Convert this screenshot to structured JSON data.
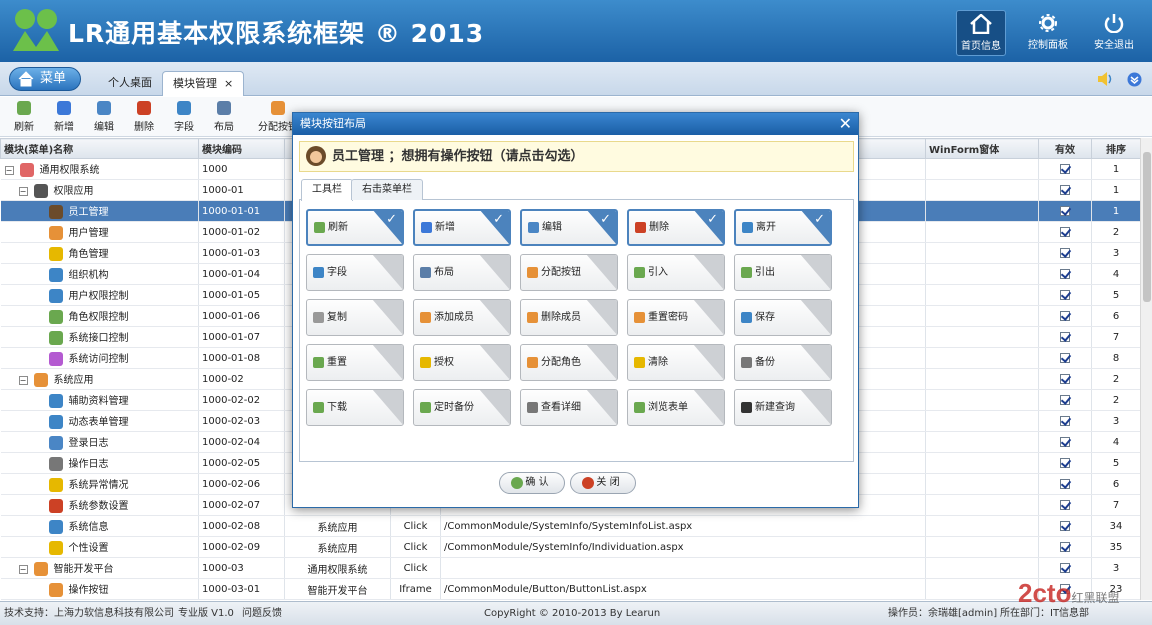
{
  "header": {
    "title": "LR通用基本权限系统框架 ® 2013",
    "buttons": [
      {
        "label": "首页信息",
        "icon": "home-icon"
      },
      {
        "label": "控制面板",
        "icon": "gear-icon"
      },
      {
        "label": "安全退出",
        "icon": "power-icon"
      }
    ]
  },
  "tabbar": {
    "menu_label": "菜单",
    "tabs": [
      {
        "label": "个人桌面"
      },
      {
        "label": "模块管理",
        "close": "×"
      }
    ]
  },
  "toolbar": {
    "buttons": [
      {
        "label": "刷新",
        "color": "#6aa84f"
      },
      {
        "label": "新增",
        "color": "#3c78d8"
      },
      {
        "label": "编辑",
        "color": "#4a86c5"
      },
      {
        "label": "删除",
        "color": "#cc4125"
      },
      {
        "label": "字段",
        "color": "#3d85c6"
      },
      {
        "label": "布局",
        "color": "#5b7ea8"
      },
      {
        "label": "分配按钮",
        "color": "#e69138"
      }
    ]
  },
  "grid": {
    "columns": [
      "模块(菜单)名称",
      "模块编码",
      "",
      "",
      "",
      "WinForm窗体",
      "有效",
      "排序"
    ],
    "rows": [
      {
        "level": 0,
        "exp": "⊟",
        "name": "通用权限系统",
        "code": "1000",
        "sort": "1",
        "color": "#e06666"
      },
      {
        "level": 1,
        "exp": "⊟",
        "name": "权限应用",
        "code": "1000-01",
        "sort": "1",
        "color": "#555555"
      },
      {
        "level": 2,
        "name": "员工管理",
        "code": "1000-01-01",
        "sort": "1",
        "color": "#6b4b2a",
        "sel": true
      },
      {
        "level": 2,
        "name": "用户管理",
        "code": "1000-01-02",
        "sort": "2",
        "color": "#e69138"
      },
      {
        "level": 2,
        "name": "角色管理",
        "code": "1000-01-03",
        "sort": "3",
        "color": "#e6b800"
      },
      {
        "level": 2,
        "name": "组织机构",
        "code": "1000-01-04",
        "sort": "4",
        "color": "#3d85c6"
      },
      {
        "level": 2,
        "name": "用户权限控制",
        "code": "1000-01-05",
        "sort": "5",
        "color": "#3d85c6"
      },
      {
        "level": 2,
        "name": "角色权限控制",
        "code": "1000-01-06",
        "sort": "6",
        "color": "#6aa84f"
      },
      {
        "level": 2,
        "name": "系统接口控制",
        "code": "1000-01-07",
        "sort": "7",
        "color": "#6aa84f"
      },
      {
        "level": 2,
        "name": "系统访问控制",
        "code": "1000-01-08",
        "sort": "8",
        "color": "#b45ad1"
      },
      {
        "level": 1,
        "exp": "⊟",
        "name": "系统应用",
        "code": "1000-02",
        "sort": "2",
        "color": "#e69138"
      },
      {
        "level": 2,
        "name": "辅助资料管理",
        "code": "1000-02-02",
        "sort": "2",
        "color": "#3d85c6"
      },
      {
        "level": 2,
        "name": "动态表单管理",
        "code": "1000-02-03",
        "sort": "3",
        "color": "#3d85c6"
      },
      {
        "level": 2,
        "name": "登录日志",
        "code": "1000-02-04",
        "sort": "4",
        "color": "#4a86c5"
      },
      {
        "level": 2,
        "name": "操作日志",
        "code": "1000-02-05",
        "sort": "5",
        "color": "#777777"
      },
      {
        "level": 2,
        "name": "系统异常情况",
        "code": "1000-02-06",
        "sort": "6",
        "color": "#e6b800"
      },
      {
        "level": 2,
        "name": "系统参数设置",
        "code": "1000-02-07",
        "sort": "7",
        "color": "#cc4125"
      },
      {
        "level": 2,
        "name": "系统信息",
        "code": "1000-02-08",
        "c3": "系统应用",
        "c4": "Click",
        "c5": "/CommonModule/SystemInfo/SystemInfoList.aspx",
        "sort": "34",
        "color": "#3d85c6"
      },
      {
        "level": 2,
        "name": "个性设置",
        "code": "1000-02-09",
        "c3": "系统应用",
        "c4": "Click",
        "c5": "/CommonModule/SystemInfo/Individuation.aspx",
        "sort": "35",
        "color": "#e6b800"
      },
      {
        "level": 1,
        "exp": "⊟",
        "name": "智能开发平台",
        "code": "1000-03",
        "c3": "通用权限系统",
        "c4": "Click",
        "c5": "",
        "sort": "3",
        "color": "#e69138"
      },
      {
        "level": 2,
        "name": "操作按钮",
        "code": "1000-03-01",
        "c3": "智能开发平台",
        "c4": "Iframe",
        "c5": "/CommonModule/Button/ButtonList.aspx",
        "sort": "23",
        "color": "#e69138"
      }
    ]
  },
  "footer": {
    "support": "技术支持：上海力软信息科技有限公司",
    "version": "专业版 V1.0",
    "feedback": "问题反馈",
    "copyright": "CopyRight © 2010-2013 By Learun",
    "operator": "操作员：余瑞雄[admin]",
    "dept": "所在部门：IT信息部"
  },
  "watermark": {
    "text": "2cto",
    "sub": "红黑联盟"
  },
  "dialog": {
    "title": "模块按钮布局",
    "subtitle": "员工管理 ；想拥有操作按钮（请点击勾选）",
    "tabs": [
      "工具栏",
      "右击菜单栏"
    ],
    "buttons": [
      {
        "label": "刷新",
        "on": true,
        "color": "#6aa84f"
      },
      {
        "label": "新增",
        "on": true,
        "color": "#3c78d8"
      },
      {
        "label": "编辑",
        "on": true,
        "color": "#4a86c5"
      },
      {
        "label": "删除",
        "on": true,
        "color": "#cc4125"
      },
      {
        "label": "离开",
        "on": true,
        "color": "#3d85c6"
      },
      {
        "label": "字段",
        "color": "#3d85c6"
      },
      {
        "label": "布局",
        "color": "#5b7ea8"
      },
      {
        "label": "分配按钮",
        "color": "#e69138"
      },
      {
        "label": "引入",
        "color": "#6aa84f"
      },
      {
        "label": "引出",
        "color": "#6aa84f"
      },
      {
        "label": "复制",
        "color": "#999999"
      },
      {
        "label": "添加成员",
        "color": "#e69138"
      },
      {
        "label": "删除成员",
        "color": "#e69138"
      },
      {
        "label": "重置密码",
        "color": "#e69138"
      },
      {
        "label": "保存",
        "color": "#3d85c6"
      },
      {
        "label": "重置",
        "color": "#6aa84f"
      },
      {
        "label": "授权",
        "color": "#e6b800"
      },
      {
        "label": "分配角色",
        "color": "#e69138"
      },
      {
        "label": "清除",
        "color": "#e6b800"
      },
      {
        "label": "备份",
        "color": "#777777"
      },
      {
        "label": "下载",
        "color": "#6aa84f"
      },
      {
        "label": "定时备份",
        "color": "#6aa84f"
      },
      {
        "label": "查看详细",
        "color": "#777777"
      },
      {
        "label": "浏览表单",
        "color": "#6aa84f"
      },
      {
        "label": "新建查询",
        "color": "#333333"
      }
    ],
    "ok": "确 认",
    "close": "关 闭"
  }
}
